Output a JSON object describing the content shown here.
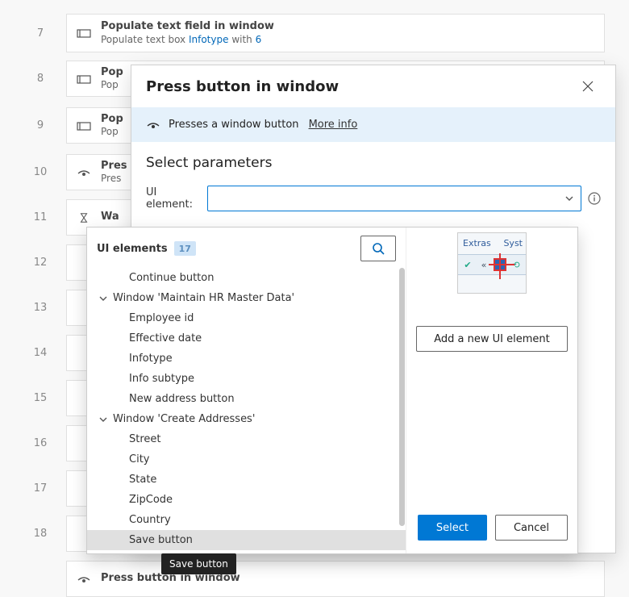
{
  "bg_steps": [
    {
      "num": "7",
      "title": "Populate text field in window",
      "sub_pre": "Populate text box ",
      "sub_blue1": "Infotype",
      "sub_mid": " with ",
      "sub_blue2": "6",
      "icon": "textbox"
    },
    {
      "num": "8",
      "title": "Pop",
      "sub_pre": "Pop",
      "sub_blue1": "",
      "sub_mid": "",
      "sub_blue2": "",
      "icon": "textbox"
    },
    {
      "num": "9",
      "title": "Pop",
      "sub_pre": "Pop",
      "sub_blue1": "",
      "sub_mid": "",
      "sub_blue2": "",
      "icon": "textbox"
    },
    {
      "num": "10",
      "title": "Pres",
      "sub_pre": "Pres",
      "sub_blue1": "",
      "sub_mid": "",
      "sub_blue2": "",
      "icon": "press"
    },
    {
      "num": "11",
      "title": "Wa",
      "sub_pre": "",
      "sub_blue1": "",
      "sub_mid": "",
      "sub_blue2": "",
      "icon": "hourglass"
    }
  ],
  "ghost_rows": [
    "12",
    "13",
    "14",
    "15",
    "16",
    "17",
    "18"
  ],
  "dialog": {
    "title": "Press button in window",
    "info_text": "Presses a window button",
    "more_info": "More info",
    "params_heading": "Select parameters",
    "uielem_label": "UI element:"
  },
  "dropdown": {
    "header_label": "UI elements",
    "count": "17",
    "groups": [
      {
        "label": "",
        "items": [
          "Continue button"
        ]
      },
      {
        "label": "Window 'Maintain HR Master Data'",
        "items": [
          "Employee id",
          "Effective date",
          "Infotype",
          "Info subtype",
          "New address button"
        ]
      },
      {
        "label": "Window 'Create Addresses'",
        "items": [
          "Street",
          "City",
          "State",
          "ZipCode",
          "Country",
          "Save button"
        ]
      }
    ],
    "add_label": "Add a new UI element",
    "select_label": "Select",
    "cancel_label": "Cancel",
    "tooltip": "Save button",
    "preview": {
      "extras": "Extras",
      "system": "Syst"
    }
  },
  "last_step": "Press button in window"
}
